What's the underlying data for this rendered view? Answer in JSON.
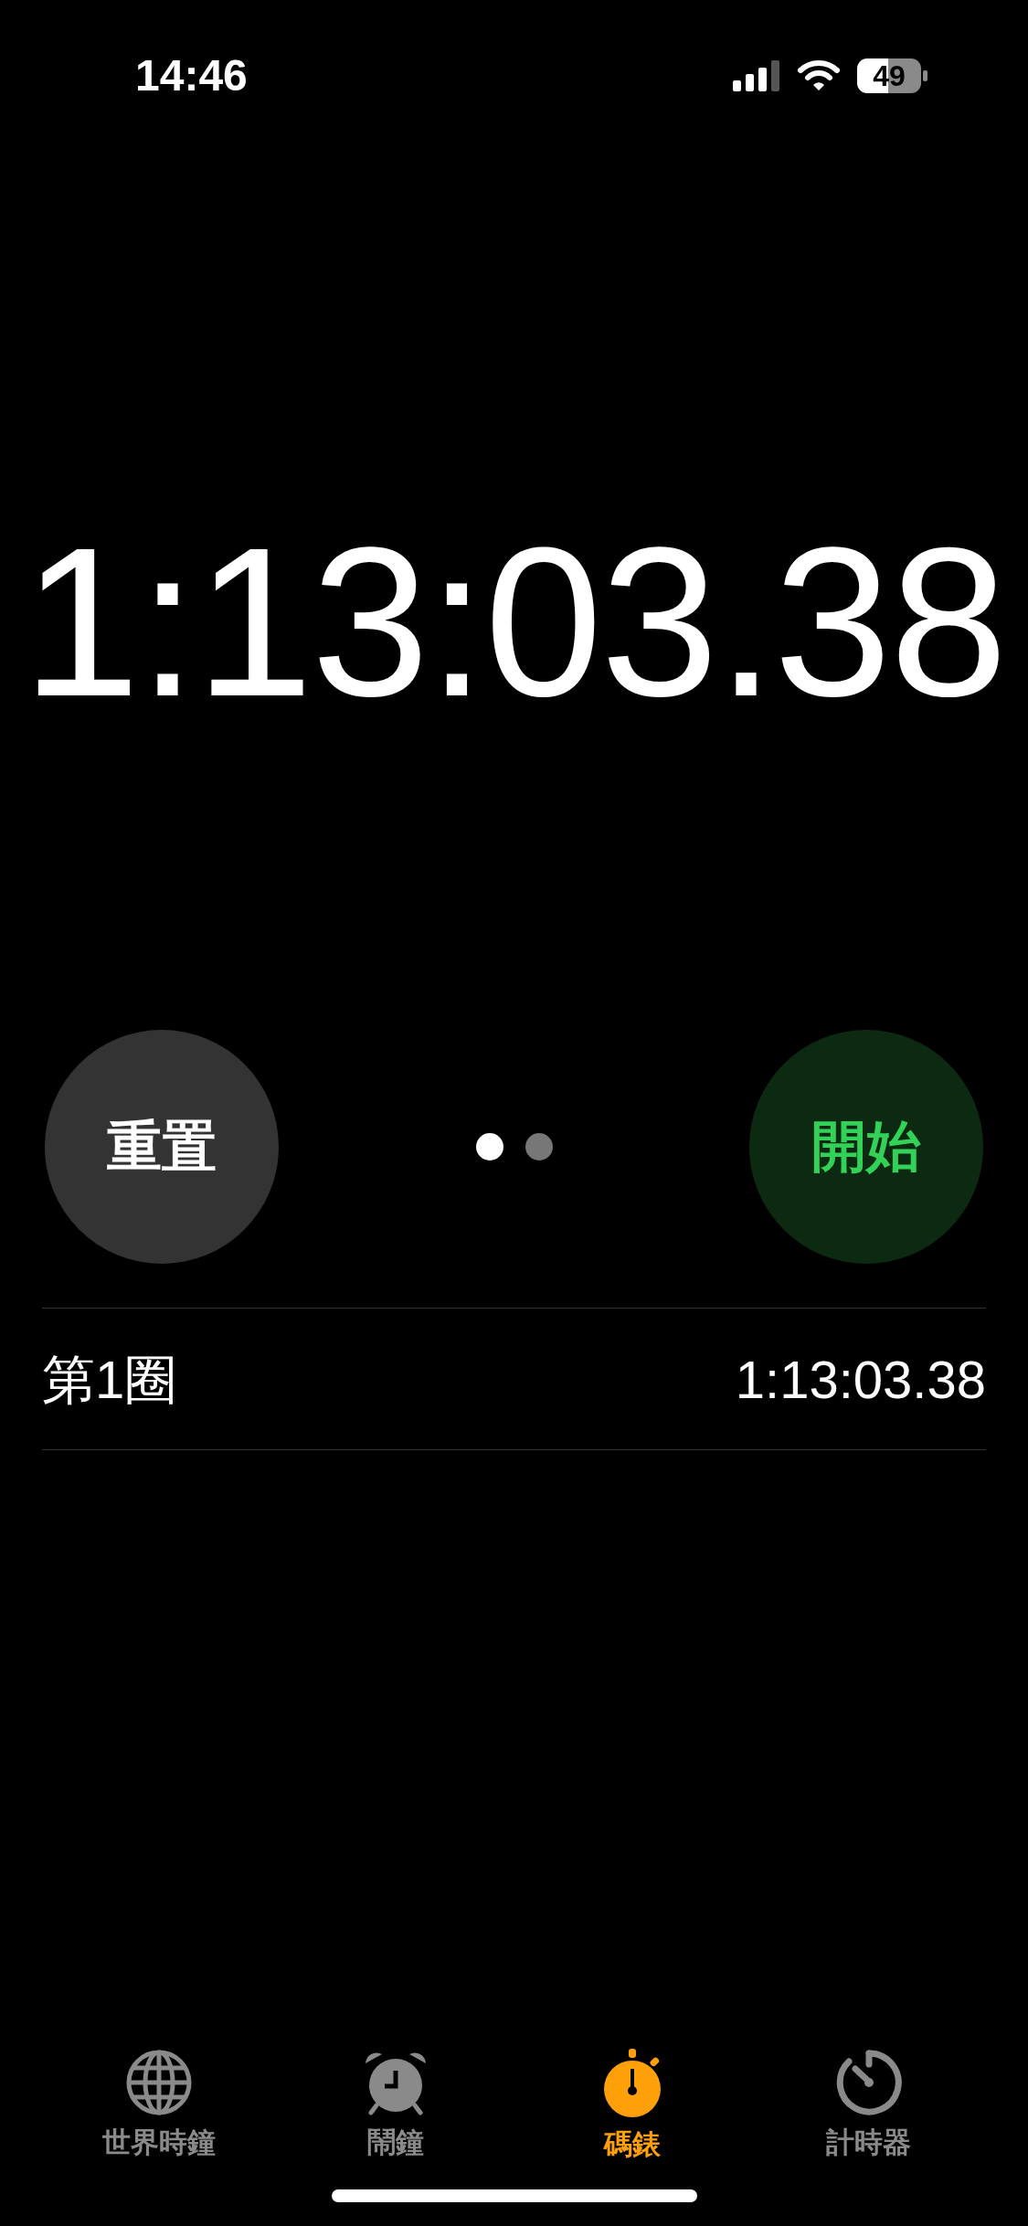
{
  "status_bar": {
    "time": "14:46",
    "battery": "49"
  },
  "stopwatch": {
    "elapsed": "1:13:03.38"
  },
  "controls": {
    "left_button": "重置",
    "right_button": "開始",
    "pages": [
      {
        "selected": true
      },
      {
        "selected": false
      }
    ]
  },
  "laps": [
    {
      "label": "第1圈",
      "time": "1:13:03.38"
    }
  ],
  "tabs": [
    {
      "kind": "globe",
      "label": "世界時鐘",
      "selected": false
    },
    {
      "kind": "alarm",
      "label": "鬧鐘",
      "selected": false
    },
    {
      "kind": "stopwatch",
      "label": "碼錶",
      "selected": true
    },
    {
      "kind": "timer",
      "label": "計時器",
      "selected": false
    }
  ]
}
